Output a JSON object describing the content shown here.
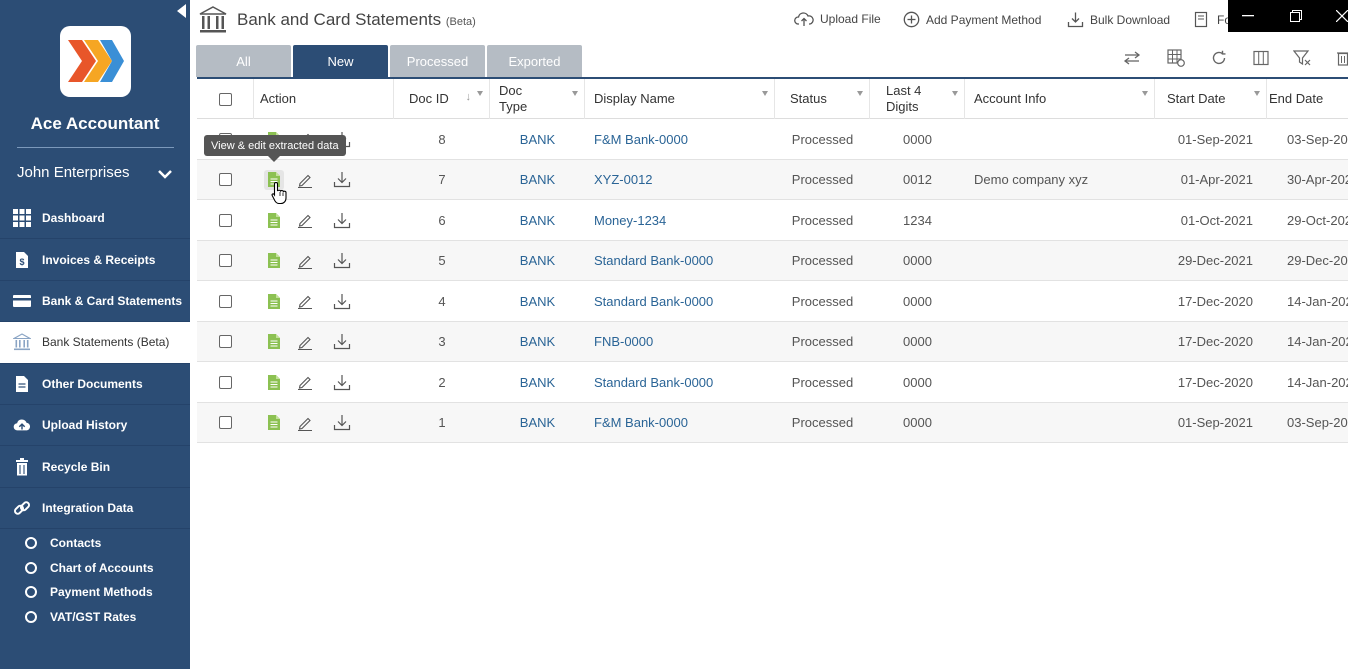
{
  "app": {
    "name": "Ace Accountant",
    "company": "John Enterprises"
  },
  "nav": [
    {
      "label": "Dashboard",
      "icon": "dashboard-icon"
    },
    {
      "label": "Invoices & Receipts",
      "icon": "invoice-icon"
    },
    {
      "label": "Bank & Card Statements",
      "icon": "card-icon"
    },
    {
      "label": "Bank Statements (Beta)",
      "icon": "bank-icon",
      "active": true
    },
    {
      "label": "Other Documents",
      "icon": "document-icon"
    },
    {
      "label": "Upload History",
      "icon": "cloud-upload-icon"
    },
    {
      "label": "Recycle Bin",
      "icon": "trash-icon"
    },
    {
      "label": "Integration Data",
      "icon": "link-icon"
    }
  ],
  "subnav": [
    "Contacts",
    "Chart of Accounts",
    "Payment Methods",
    "VAT/GST Rates"
  ],
  "header": {
    "title": "Bank and Card Statements",
    "title_tag": "(Beta)",
    "upload": "Upload File",
    "add_payment": "Add Payment Method",
    "bulk_download": "Bulk Download",
    "more": "Fo"
  },
  "tabs": [
    "All",
    "New",
    "Processed",
    "Exported"
  ],
  "columns": {
    "action": "Action",
    "doc_id": "Doc ID",
    "doc_type": "Doc Type",
    "display_name": "Display Name",
    "status": "Status",
    "last4": "Last 4 Digits",
    "account_info": "Account Info",
    "start_date": "Start Date",
    "end_date": "End Date"
  },
  "tooltip": "View & edit extracted data",
  "rows": [
    {
      "id": "8",
      "type": "BANK",
      "name": "F&M Bank-0000",
      "status": "Processed",
      "last4": "0000",
      "account": "",
      "start": "01-Sep-2021",
      "end": "03-Sep-202"
    },
    {
      "id": "7",
      "type": "BANK",
      "name": "XYZ-0012",
      "status": "Processed",
      "last4": "0012",
      "account": "Demo company xyz",
      "start": "01-Apr-2021",
      "end": "30-Apr-202"
    },
    {
      "id": "6",
      "type": "BANK",
      "name": "Money-1234",
      "status": "Processed",
      "last4": "1234",
      "account": "",
      "start": "01-Oct-2021",
      "end": "29-Oct-202"
    },
    {
      "id": "5",
      "type": "BANK",
      "name": "Standard Bank-0000",
      "status": "Processed",
      "last4": "0000",
      "account": "",
      "start": "29-Dec-2021",
      "end": "29-Dec-202"
    },
    {
      "id": "4",
      "type": "BANK",
      "name": "Standard Bank-0000",
      "status": "Processed",
      "last4": "0000",
      "account": "",
      "start": "17-Dec-2020",
      "end": "14-Jan-202"
    },
    {
      "id": "3",
      "type": "BANK",
      "name": "FNB-0000",
      "status": "Processed",
      "last4": "0000",
      "account": "",
      "start": "17-Dec-2020",
      "end": "14-Jan-202"
    },
    {
      "id": "2",
      "type": "BANK",
      "name": "Standard Bank-0000",
      "status": "Processed",
      "last4": "0000",
      "account": "",
      "start": "17-Dec-2020",
      "end": "14-Jan-202"
    },
    {
      "id": "1",
      "type": "BANK",
      "name": "F&M Bank-0000",
      "status": "Processed",
      "last4": "0000",
      "account": "",
      "start": "01-Sep-2021",
      "end": "03-Sep-202"
    }
  ],
  "colors": {
    "sidebar": "#2c4d75",
    "link": "#2a6496",
    "tab_inactive": "#b5bcc4",
    "doc_icon": "#8cc152"
  }
}
